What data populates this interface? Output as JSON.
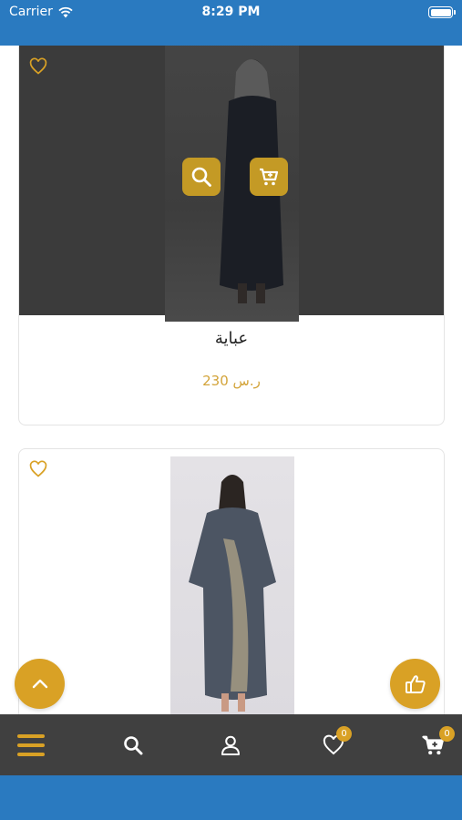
{
  "status_bar": {
    "carrier": "Carrier",
    "time": "8:29 PM"
  },
  "products": [
    {
      "title": "عباية",
      "price": "230 ر.س"
    },
    {
      "title": "",
      "price": ""
    }
  ],
  "bottom_nav": {
    "favorites_count": "0",
    "cart_count": "0"
  },
  "colors": {
    "brand_blue": "#2a7ac0",
    "accent_gold": "#d9a125",
    "nav_bg": "#404040",
    "price_color": "#d3a43a"
  },
  "icons": {
    "menu": "menu-icon",
    "search": "search-icon",
    "user": "user-icon",
    "favorites": "heart-icon",
    "cart": "cart-icon",
    "scroll_top": "chevron-up-icon",
    "like": "thumbs-up-icon"
  }
}
